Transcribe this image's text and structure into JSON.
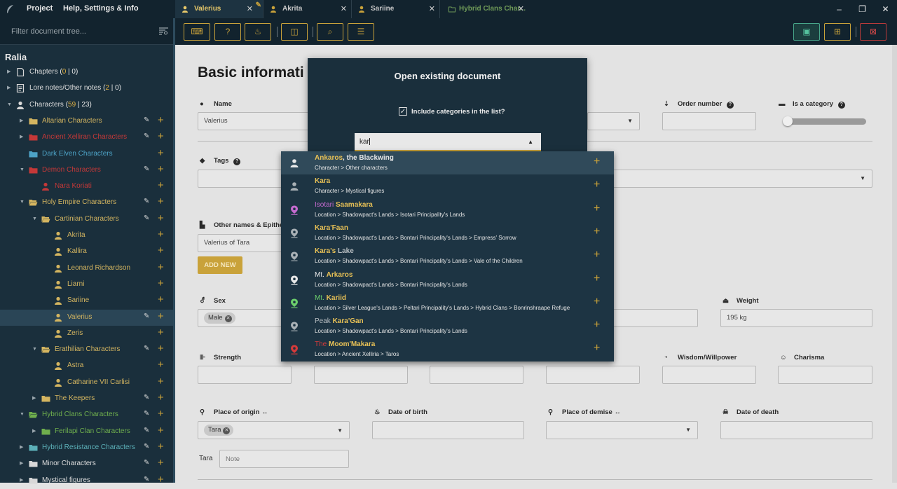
{
  "app": {
    "menu": [
      "Project",
      "Help, Settings & Info"
    ]
  },
  "tabs": [
    {
      "label": "Valerius",
      "icon": "person-icon",
      "active": true
    },
    {
      "label": "Akrita",
      "icon": "person-icon",
      "active": false
    },
    {
      "label": "Sariine",
      "icon": "person-icon",
      "active": false
    },
    {
      "label": "Hybrid Clans Char...",
      "icon": "folder-icon",
      "active": false
    }
  ],
  "window_controls": {
    "minimize": "–",
    "maximize": "❐",
    "close": "✕"
  },
  "colors": {
    "accent": "#c9a23a",
    "sidebar": "#1a2f3c",
    "topbar": "#12232e",
    "save": "#47a68a",
    "delete": "#b93a3a"
  },
  "sidebar": {
    "filter_placeholder": "Filter document tree...",
    "root": "Ralia",
    "items": [
      {
        "label": "Chapters",
        "count_a": "0",
        "count_b": "0",
        "level": 0,
        "icon": "document-icon",
        "color": "white",
        "expand": "right",
        "edit": false,
        "add": false
      },
      {
        "label": "Lore notes/Other notes",
        "count_a": "2",
        "count_b": "0",
        "level": 0,
        "icon": "notes-icon",
        "color": "white",
        "expand": "right",
        "edit": false,
        "add": false
      },
      {
        "label": "Characters",
        "count_a": "59",
        "count_b": "23",
        "level": 0,
        "icon": "person-icon",
        "color": "white",
        "expand": "down",
        "edit": false,
        "add": false
      },
      {
        "label": "Altarian Characters",
        "level": 1,
        "icon": "folder-icon",
        "color": "gold",
        "expand": "right",
        "edit": true,
        "add": true
      },
      {
        "label": "Ancient Xelliran Characters",
        "level": 1,
        "icon": "folder-icon",
        "color": "red",
        "expand": "right",
        "edit": true,
        "add": true
      },
      {
        "label": "Dark Elven Characters",
        "level": 1,
        "icon": "folder-icon",
        "color": "blue",
        "expand": "none",
        "edit": false,
        "add": true
      },
      {
        "label": "Demon Characters",
        "level": 1,
        "icon": "folder-icon",
        "color": "red",
        "expand": "down",
        "edit": true,
        "add": true
      },
      {
        "label": "Nara Koriati",
        "level": 2,
        "icon": "person-icon",
        "color": "red",
        "expand": "none",
        "edit": false,
        "add": true
      },
      {
        "label": "Holy Empire Characters",
        "level": 1,
        "icon": "folder-open-icon",
        "color": "gold",
        "expand": "down",
        "edit": true,
        "add": true
      },
      {
        "label": "Cartinian Characters",
        "level": 2,
        "icon": "folder-open-icon",
        "color": "gold",
        "expand": "down",
        "edit": true,
        "add": true
      },
      {
        "label": "Akrita",
        "level": 3,
        "icon": "person-icon",
        "color": "gold",
        "expand": "none",
        "edit": false,
        "add": true
      },
      {
        "label": "Kallira",
        "level": 3,
        "icon": "person-icon",
        "color": "gold",
        "expand": "none",
        "edit": false,
        "add": true
      },
      {
        "label": "Leonard Richardson",
        "level": 3,
        "icon": "person-icon",
        "color": "gold",
        "expand": "none",
        "edit": false,
        "add": true
      },
      {
        "label": "Liarni",
        "level": 3,
        "icon": "person-icon",
        "color": "gold",
        "expand": "none",
        "edit": false,
        "add": true
      },
      {
        "label": "Sariine",
        "level": 3,
        "icon": "person-icon",
        "color": "gold",
        "expand": "none",
        "edit": false,
        "add": true
      },
      {
        "label": "Valerius",
        "level": 3,
        "icon": "person-icon",
        "color": "gold",
        "expand": "none",
        "edit": true,
        "add": true,
        "selected": true
      },
      {
        "label": "Zeris",
        "level": 3,
        "icon": "person-icon",
        "color": "gold",
        "expand": "none",
        "edit": false,
        "add": true
      },
      {
        "label": "Erathilian Characters",
        "level": 2,
        "icon": "folder-open-icon",
        "color": "gold",
        "expand": "down",
        "edit": true,
        "add": true
      },
      {
        "label": "Astra",
        "level": 3,
        "icon": "person-icon",
        "color": "gold",
        "expand": "none",
        "edit": false,
        "add": true
      },
      {
        "label": "Catharine VII Carlisi",
        "level": 3,
        "icon": "person-icon",
        "color": "gold",
        "expand": "none",
        "edit": false,
        "add": true
      },
      {
        "label": "The Keepers",
        "level": 2,
        "icon": "folder-icon",
        "color": "gold",
        "expand": "right",
        "edit": true,
        "add": true
      },
      {
        "label": "Hybrid Clans Characters",
        "level": 1,
        "icon": "folder-open-icon",
        "color": "green",
        "expand": "down",
        "edit": true,
        "add": true
      },
      {
        "label": "Ferilapi Clan Characters",
        "level": 2,
        "icon": "folder-icon",
        "color": "green",
        "expand": "right",
        "edit": true,
        "add": true
      },
      {
        "label": "Hybrid Resistance Characters",
        "level": 1,
        "icon": "folder-icon",
        "color": "teal",
        "expand": "right",
        "edit": true,
        "add": true
      },
      {
        "label": "Minor Characters",
        "level": 1,
        "icon": "folder-icon",
        "color": "white",
        "expand": "right",
        "edit": true,
        "add": true
      },
      {
        "label": "Mystical figures",
        "level": 1,
        "icon": "folder-icon",
        "color": "white",
        "expand": "right",
        "edit": true,
        "add": true
      }
    ]
  },
  "toolbar": {
    "left": [
      "keyboard-icon",
      "help-document-icon",
      "fire-icon",
      "box-icon",
      "search-database-icon",
      "add-note-icon"
    ],
    "right": [
      "save-icon",
      "tree-icon",
      "delete-document-icon"
    ]
  },
  "form": {
    "title": "Basic informati",
    "name_label": "Name",
    "name_value": "Valerius",
    "order_label": "Order number",
    "order_help": "?",
    "category_label": "Is a category",
    "category_help": "?",
    "tags_label": "Tags",
    "tags_help": "?",
    "other_names_label": "Other names & Epithe",
    "other_names_value": "Valerius of Tara",
    "add_new": "ADD NEW",
    "sex_label": "Sex",
    "sex_chip": "Male",
    "weight_label": "Weight",
    "weight_value": "195 kg",
    "strength_label": "Strength",
    "wisdom_label": "Wisdom/Willpower",
    "charisma_label": "Charisma",
    "origin_label": "Place of origin",
    "origin_chip": "Tara",
    "dob_label": "Date of birth",
    "demise_label": "Place of demise",
    "dod_label": "Date of death",
    "note_label": "Tara",
    "note_placeholder": "Note"
  },
  "dialog": {
    "title": "Open existing document",
    "checkbox_label": "Include categories in the list?",
    "checkbox_checked": true,
    "search_value": "kar"
  },
  "results": [
    {
      "pre": "",
      "match": "Ankaros",
      "post": ", the Blackwing",
      "path": "Character > Other characters",
      "icon": "person-icon",
      "icon_color": "#e8e8e8",
      "pre_color": "#e8e8e8",
      "post_color": "#e8e8e8"
    },
    {
      "pre": "",
      "match": "Kara",
      "post": "",
      "path": "Character > Mystical figures",
      "icon": "person-icon",
      "icon_color": "#a8b0b5",
      "pre_color": "#e8e8e8",
      "post_color": "#e8e8e8"
    },
    {
      "pre": "Isotari ",
      "match": "Saamakara",
      "post": "",
      "path": "Location > Shadowpact's Lands > Isotari Principality's Lands",
      "icon": "map-pin-icon",
      "icon_color": "#c56bd0",
      "pre_color": "#c56bd0",
      "post_color": "#e8e8e8"
    },
    {
      "pre": "",
      "match": "Kara'Faan",
      "post": "",
      "path": "Location > Shadowpact's Lands > Bontari Principality's Lands > Empress' Sorrow",
      "icon": "map-pin-icon",
      "icon_color": "#a8b0b5",
      "pre_color": "#e8e8e8",
      "post_color": "#e8e8e8"
    },
    {
      "pre": "",
      "match": "Kara's",
      "post": " Lake",
      "path": "Location > Shadowpact's Lands > Bontari Principality's Lands > Vale of the Children",
      "icon": "map-pin-icon",
      "icon_color": "#a8b0b5",
      "pre_color": "#e8e8e8",
      "post_color": "#b8bec2"
    },
    {
      "pre": "Mt. ",
      "match": "Arkaros",
      "post": "",
      "path": "Location > Shadowpact's Lands > Bontari Principality's Lands",
      "icon": "map-pin-icon",
      "icon_color": "#e8e8e8",
      "pre_color": "#e8e8e8",
      "post_color": "#e8e8e8"
    },
    {
      "pre": "Mt. ",
      "match": "Kariid",
      "post": "",
      "path": "Location > Silver League's Lands > Peltari Principality's Lands > Hybrid Clans > Bonrinshraape Refuge",
      "icon": "map-pin-icon",
      "icon_color": "#6ccf6c",
      "pre_color": "#6ccf6c",
      "post_color": "#e8e8e8"
    },
    {
      "pre": "Peak ",
      "match": "Kara'Gan",
      "post": "",
      "path": "Location > Shadowpact's Lands > Bontari Principality's Lands",
      "icon": "map-pin-icon",
      "icon_color": "#a8b0b5",
      "pre_color": "#b8bec2",
      "post_color": "#e8e8e8"
    },
    {
      "pre": "The ",
      "match": "Moom'Makara",
      "post": "",
      "path": "Location > Ancient Xelliria > Taros",
      "icon": "map-pin-icon",
      "icon_color": "#d43a3a",
      "pre_color": "#d43a3a",
      "post_color": "#e8e8e8"
    }
  ]
}
